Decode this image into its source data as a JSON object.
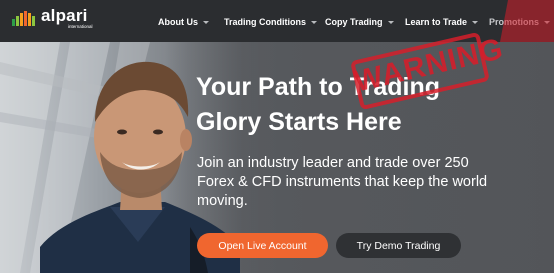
{
  "brand": {
    "name": "alpari",
    "tagline": "international",
    "colors": {
      "bars": [
        "#f0662f",
        "#f7a01e",
        "#8cc63f",
        "#2e9f47"
      ]
    }
  },
  "nav": {
    "items": [
      {
        "label": "About Us"
      },
      {
        "label": "Trading Conditions"
      },
      {
        "label": "Copy Trading"
      },
      {
        "label": "Learn to Trade"
      },
      {
        "label": "Promotions"
      }
    ],
    "background": "#2b2d30"
  },
  "hero": {
    "headline_line1": "Your Path to Trading",
    "headline_line2": "Glory Starts Here",
    "subcopy": "Join an industry leader and trade over 250 Forex & CFD instruments that keep the world moving."
  },
  "actions": {
    "live_label": "Open Live Account",
    "demo_label": "Try Demo Trading",
    "live_color": "#f0662f",
    "demo_color": "#2f3134"
  },
  "stamp": {
    "text": "WARNING",
    "color": "#d61e2a"
  }
}
